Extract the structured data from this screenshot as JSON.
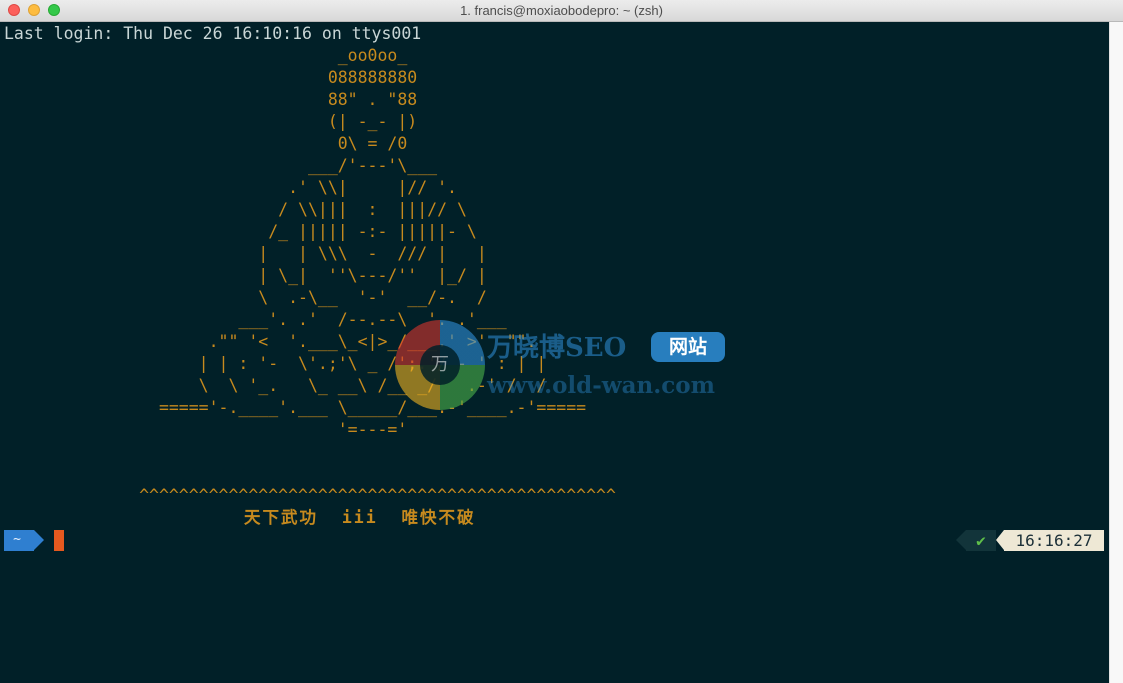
{
  "window": {
    "title": "1. francis@moxiaobodepro: ~ (zsh)"
  },
  "terminal": {
    "login_line": "Last login: Thu Dec 26 16:10:16 on ttys001",
    "ascii_art": "                                  _oo0oo_\n                                 088888880\n                                 88\" . \"88\n                                 (| -_- |)\n                                  0\\ = /0\n                               ___/'---'\\___\n                             .' \\\\|     |// '.\n                            / \\\\|||  :  |||// \\\n                           /_ ||||| -:- |||||- \\\n                          |   | \\\\\\  -  /// |   |\n                          | \\_|  ''\\---/''  |_/ |\n                          \\  .-\\__  '-'  __/-.  /\n                        ___'. .'  /--.--\\  '. .'___\n                     .\"\" '<  '.___\\_<|>_/___.' >'  \"\".\n                    | | : '-  \\'.;'\\ _ /';.'/ - ' : | |\n                    \\  \\ '_.   \\_ __\\ /__ _/   .-' /  /\n                ====='-.____'.___ \\_____/___.-'____.-'=====\n                                  '=---='",
    "motto_line": "              ^^^^^^^^^^^^^^^^^^^^^^^^^^^^^^^^^^^^^^^^^^^^^^^^",
    "motto_text": "天下武功  iii  唯快不破"
  },
  "prompt": {
    "directory": "~",
    "status_icon": "check-icon",
    "status_glyph": "✔",
    "time": "16:16:27"
  },
  "watermark": {
    "glyph": "万",
    "name": "万晓博SEO",
    "badge": "网站",
    "url": "www.old-wan.com"
  },
  "colors": {
    "background": "#012028",
    "ascii": "#c78a1e",
    "prompt_accent": "#2f7fd0",
    "cursor": "#e5591f",
    "ok": "#5fbf4a"
  }
}
